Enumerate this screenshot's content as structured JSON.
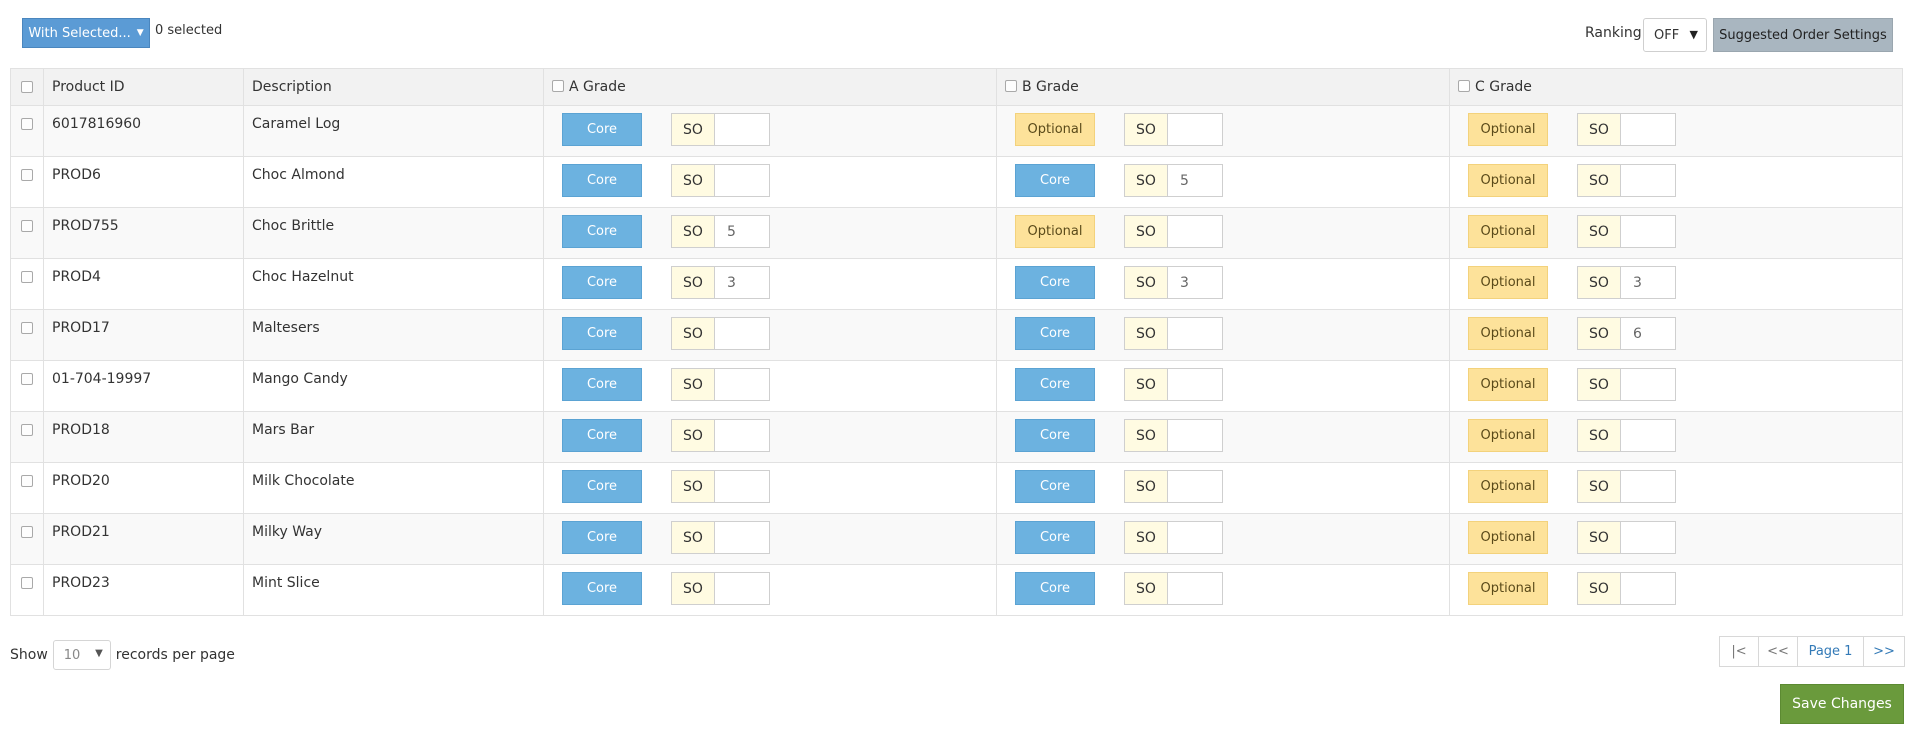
{
  "toolbar": {
    "with_selected_label": "With Selected...",
    "selected_count": "0 selected",
    "ranking_label": "Ranking",
    "ranking_value": "OFF",
    "suggested_order_settings_label": "Suggested Order Settings"
  },
  "table": {
    "headers": {
      "product_id": "Product ID",
      "description": "Description",
      "grade_a": "A Grade",
      "grade_b": "B Grade",
      "grade_c": "C Grade"
    },
    "so_label": "SO",
    "rows": [
      {
        "product_id": "6017816960",
        "description": "Caramel Log",
        "a": {
          "type": "Core",
          "so": ""
        },
        "b": {
          "type": "Optional",
          "so": ""
        },
        "c": {
          "type": "Optional",
          "so": ""
        }
      },
      {
        "product_id": "PROD6",
        "description": "Choc Almond",
        "a": {
          "type": "Core",
          "so": ""
        },
        "b": {
          "type": "Core",
          "so": "5"
        },
        "c": {
          "type": "Optional",
          "so": ""
        }
      },
      {
        "product_id": "PROD755",
        "description": "Choc Brittle",
        "a": {
          "type": "Core",
          "so": "5"
        },
        "b": {
          "type": "Optional",
          "so": ""
        },
        "c": {
          "type": "Optional",
          "so": ""
        }
      },
      {
        "product_id": "PROD4",
        "description": "Choc Hazelnut",
        "a": {
          "type": "Core",
          "so": "3"
        },
        "b": {
          "type": "Core",
          "so": "3"
        },
        "c": {
          "type": "Optional",
          "so": "3"
        }
      },
      {
        "product_id": "PROD17",
        "description": "Maltesers",
        "a": {
          "type": "Core",
          "so": ""
        },
        "b": {
          "type": "Core",
          "so": ""
        },
        "c": {
          "type": "Optional",
          "so": "6"
        }
      },
      {
        "product_id": "01-704-19997",
        "description": "Mango Candy",
        "a": {
          "type": "Core",
          "so": ""
        },
        "b": {
          "type": "Core",
          "so": ""
        },
        "c": {
          "type": "Optional",
          "so": ""
        }
      },
      {
        "product_id": "PROD18",
        "description": "Mars Bar",
        "a": {
          "type": "Core",
          "so": ""
        },
        "b": {
          "type": "Core",
          "so": ""
        },
        "c": {
          "type": "Optional",
          "so": ""
        }
      },
      {
        "product_id": "PROD20",
        "description": "Milk Chocolate",
        "a": {
          "type": "Core",
          "so": ""
        },
        "b": {
          "type": "Core",
          "so": ""
        },
        "c": {
          "type": "Optional",
          "so": ""
        }
      },
      {
        "product_id": "PROD21",
        "description": "Milky Way",
        "a": {
          "type": "Core",
          "so": ""
        },
        "b": {
          "type": "Core",
          "so": ""
        },
        "c": {
          "type": "Optional",
          "so": ""
        }
      },
      {
        "product_id": "PROD23",
        "description": "Mint Slice",
        "a": {
          "type": "Core",
          "so": ""
        },
        "b": {
          "type": "Core",
          "so": ""
        },
        "c": {
          "type": "Optional",
          "so": ""
        }
      }
    ]
  },
  "footer": {
    "show_label": "Show",
    "per_page_value": "10",
    "records_label": "records per page",
    "pager": {
      "first": "|<",
      "prev": "<<",
      "page": "Page 1",
      "next": ">>"
    },
    "save_label": "Save Changes"
  },
  "colors": {
    "core": "#6cb2e0",
    "optional": "#fde29a",
    "primary": "#5b9bd5",
    "save": "#6a9a3c",
    "settings": "#a9b6c0"
  }
}
